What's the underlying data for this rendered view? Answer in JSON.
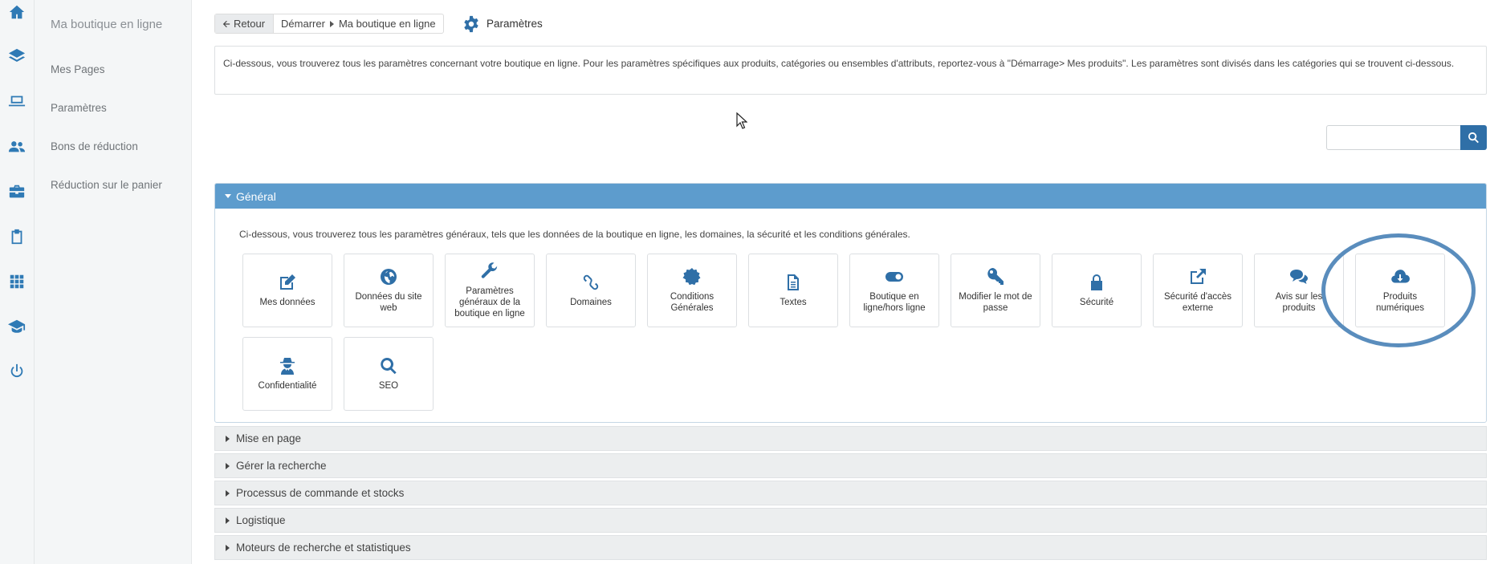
{
  "subnav": {
    "title": "Ma boutique en ligne",
    "items": [
      {
        "label": "Mes Pages"
      },
      {
        "label": "Paramètres"
      },
      {
        "label": "Bons de réduction"
      },
      {
        "label": "Réduction sur le panier"
      }
    ]
  },
  "rail": {
    "icons": [
      "home-icon",
      "layers-icon",
      "laptop-icon",
      "users-icon",
      "briefcase-icon",
      "clipboard-icon",
      "apps-grid-icon",
      "graduation-cap-icon",
      "power-icon"
    ]
  },
  "breadcrumb": {
    "back_label": "Retour",
    "crumb1": "Démarrer",
    "crumb2": "Ma boutique en ligne"
  },
  "page_title": "Paramètres",
  "info_text": "Ci-dessous, vous trouverez tous les paramètres concernant votre boutique en ligne. Pour les paramètres spécifiques aux produits, catégories ou ensembles d'attributs, reportez-vous à \"Démarrage> Mes produits\". Les paramètres sont divisés dans les catégories qui se trouvent ci-dessous.",
  "search": {
    "value": "",
    "placeholder": ""
  },
  "general": {
    "title": "Général",
    "description": "Ci-dessous, vous trouverez tous les paramètres généraux, tels que les données de la boutique en ligne, les domaines, la sécurité et les conditions générales.",
    "tiles": [
      {
        "label": "Mes données",
        "icon": "edit-icon"
      },
      {
        "label": "Données du site web",
        "icon": "globe-icon"
      },
      {
        "label": "Paramètres généraux de la boutique en ligne",
        "icon": "wrench-icon"
      },
      {
        "label": "Domaines",
        "icon": "link-icon"
      },
      {
        "label": "Conditions Générales",
        "icon": "seal-icon"
      },
      {
        "label": "Textes",
        "icon": "document-icon"
      },
      {
        "label": "Boutique en ligne/hors ligne",
        "icon": "toggle-icon"
      },
      {
        "label": "Modifier le mot de passe",
        "icon": "key-icon"
      },
      {
        "label": "Sécurité",
        "icon": "lock-icon"
      },
      {
        "label": "Sécurité d'accès externe",
        "icon": "external-link-icon"
      },
      {
        "label": "Avis sur les produits",
        "icon": "comments-icon"
      },
      {
        "label": "Produits numériques",
        "icon": "cloud-download-icon"
      },
      {
        "label": "Confidentialité",
        "icon": "user-secret-icon"
      },
      {
        "label": "SEO",
        "icon": "search-icon"
      }
    ]
  },
  "sections": [
    {
      "label": "Mise en page"
    },
    {
      "label": "Gérer la recherche"
    },
    {
      "label": "Processus de commande et stocks"
    },
    {
      "label": "Logistique"
    },
    {
      "label": "Moteurs de recherche et statistiques"
    }
  ],
  "colors": {
    "accent": "#2f6fa7",
    "panel_header": "#5d9ccd",
    "highlight_ring": "#5a8dbd"
  }
}
